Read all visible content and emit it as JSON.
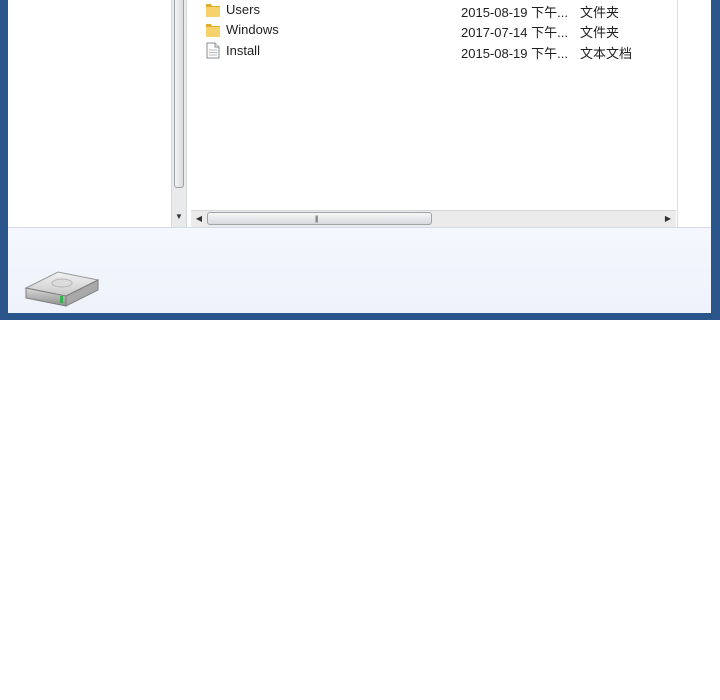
{
  "files": [
    {
      "name": "Users",
      "date": "2015-08-19 下午...",
      "type": "文件夹",
      "icon": "folder-icon"
    },
    {
      "name": "Windows",
      "date": "2017-07-14 下午...",
      "type": "文件夹",
      "icon": "folder-icon"
    },
    {
      "name": "Install",
      "date": "2015-08-19 下午...",
      "type": "文本文档",
      "icon": "text-file-icon"
    }
  ],
  "details": {
    "icon": "hard-drive-icon"
  },
  "colors": {
    "window_frame": "#29558a",
    "details_bg": "#eef2fa",
    "folder": "#f1c64b"
  }
}
